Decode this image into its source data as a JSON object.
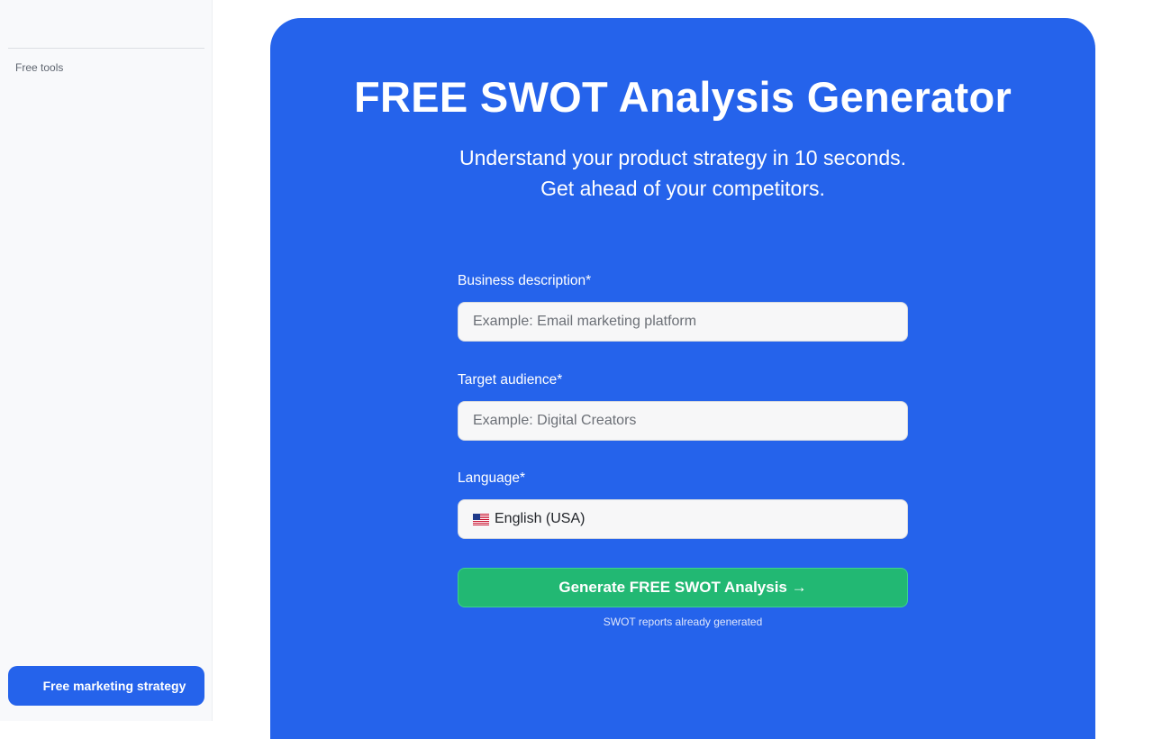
{
  "sidebar": {
    "section_label": "Free tools",
    "cta_label": "Free marketing strategy"
  },
  "hero": {
    "title": "FREE SWOT Analysis Generator",
    "subtitle_line1": "Understand your product strategy in 10 seconds.",
    "subtitle_line2": "Get ahead of your competitors."
  },
  "form": {
    "business_label": "Business description*",
    "business_placeholder": "Example: Email marketing platform",
    "business_value": "",
    "audience_label": "Target audience*",
    "audience_placeholder": "Example: Digital Creators",
    "audience_value": "",
    "language_label": "Language*",
    "language_value": "English (USA)",
    "language_flag_icon": "us-flag-icon",
    "submit_label": "Generate FREE SWOT Analysis →",
    "stats_text": "SWOT reports already generated"
  },
  "colors": {
    "brand_blue": "#2563eb",
    "cta_green": "#22b873",
    "sidebar_bg": "#f8f9fb"
  }
}
